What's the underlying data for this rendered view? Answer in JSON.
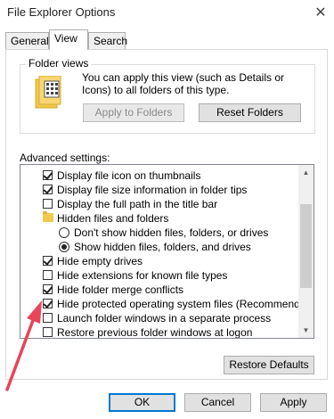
{
  "window": {
    "title": "File Explorer Options",
    "close_glyph": "✕"
  },
  "tabs": [
    {
      "label": "General"
    },
    {
      "label": "View",
      "active": true
    },
    {
      "label": "Search"
    }
  ],
  "folder_views": {
    "legend": "Folder views",
    "description": "You can apply this view (such as Details or Icons) to all folders of this type.",
    "apply_label": "Apply to Folders",
    "reset_label": "Reset Folders"
  },
  "advanced": {
    "label": "Advanced settings:",
    "items": [
      {
        "type": "checkbox",
        "checked": true,
        "label": "Display file icon on thumbnails"
      },
      {
        "type": "checkbox",
        "checked": true,
        "label": "Display file size information in folder tips"
      },
      {
        "type": "checkbox",
        "checked": false,
        "label": "Display the full path in the title bar"
      },
      {
        "type": "folder",
        "label": "Hidden files and folders"
      },
      {
        "type": "radio",
        "selected": false,
        "label": "Don't show hidden files, folders, or drives"
      },
      {
        "type": "radio",
        "selected": true,
        "label": "Show hidden files, folders, and drives"
      },
      {
        "type": "checkbox",
        "checked": true,
        "label": "Hide empty drives"
      },
      {
        "type": "checkbox",
        "checked": false,
        "label": "Hide extensions for known file types"
      },
      {
        "type": "checkbox",
        "checked": true,
        "label": "Hide folder merge conflicts"
      },
      {
        "type": "checkbox",
        "checked": true,
        "label": "Hide protected operating system files (Recommended)"
      },
      {
        "type": "checkbox",
        "checked": false,
        "label": "Launch folder windows in a separate process"
      },
      {
        "type": "checkbox",
        "checked": false,
        "label": "Restore previous folder windows at logon"
      }
    ],
    "restore_label": "Restore Defaults"
  },
  "footer": {
    "ok_label": "OK",
    "cancel_label": "Cancel",
    "apply_label": "Apply"
  },
  "colors": {
    "annotation_arrow": "#e8445a",
    "accent": "#0078d7"
  }
}
